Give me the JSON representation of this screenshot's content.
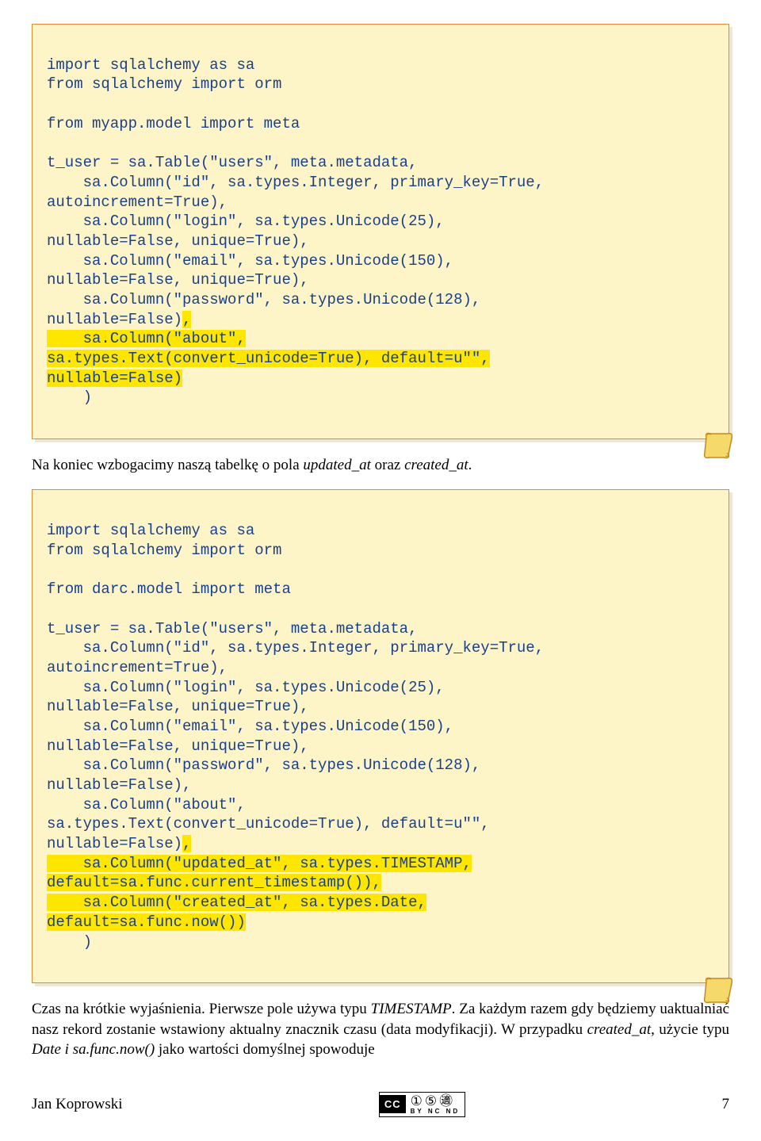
{
  "code1": {
    "l01": "import sqlalchemy as sa",
    "l02": "from sqlalchemy import orm",
    "l03": "",
    "l04": "from myapp.model import meta",
    "l05": "",
    "l06": "t_user = sa.Table(\"users\", meta.metadata,",
    "l07": "    sa.Column(\"id\", sa.types.Integer, primary_key=True,",
    "l08": "autoincrement=True),",
    "l09": "    sa.Column(\"login\", sa.types.Unicode(25),",
    "l10": "nullable=False, unique=True),",
    "l11": "    sa.Column(\"email\", sa.types.Unicode(150),",
    "l12": "nullable=False, unique=True),",
    "l13": "    sa.Column(\"password\", sa.types.Unicode(128),",
    "l14a": "nullable=False)",
    "l14b": ",",
    "l15": "    sa.Column(\"about\",",
    "l16": "sa.types.Text(convert_unicode=True), default=u\"\",",
    "l17": "nullable=False)",
    "l18": "    )"
  },
  "para1": {
    "t1": "Na koniec wzbogacimy naszą tabelkę o pola ",
    "i1": "updated_at",
    "t2": " oraz ",
    "i2": "created_at",
    "t3": "."
  },
  "code2": {
    "l01": "import sqlalchemy as sa",
    "l02": "from sqlalchemy import orm",
    "l03": "",
    "l04": "from darc.model import meta",
    "l05": "",
    "l06": "t_user = sa.Table(\"users\", meta.metadata,",
    "l07": "    sa.Column(\"id\", sa.types.Integer, primary_key=True,",
    "l08": "autoincrement=True),",
    "l09": "    sa.Column(\"login\", sa.types.Unicode(25),",
    "l10": "nullable=False, unique=True),",
    "l11": "    sa.Column(\"email\", sa.types.Unicode(150),",
    "l12": "nullable=False, unique=True),",
    "l13": "    sa.Column(\"password\", sa.types.Unicode(128),",
    "l14": "nullable=False),",
    "l15": "    sa.Column(\"about\",",
    "l16": "sa.types.Text(convert_unicode=True), default=u\"\",",
    "l17a": "nullable=False)",
    "l17b": ",",
    "l18": "    sa.Column(\"updated_at\", sa.types.TIMESTAMP,",
    "l19": "default=sa.func.current_timestamp()),",
    "l20": "    sa.Column(\"created_at\", sa.types.Date,",
    "l21": "default=sa.func.now())",
    "l22": "    )"
  },
  "para2": {
    "t1": "Czas na krótkie wyjaśnienia. Pierwsze pole używa typu ",
    "i1": "TIMESTAMP",
    "t2": ". Za każdym razem gdy będziemy uaktualniać nasz rekord zostanie wstawiony aktualny znacznik czasu (data modyfikacji). W przypadku ",
    "i2": "created_at",
    "t3": ", użycie typu ",
    "i3": "Date i sa.func.now()",
    "t4": " jako wartości domyślnej spowoduje"
  },
  "footer": {
    "author": "Jan Koprowski",
    "cc_left": "CC",
    "cc_sub": "BY  NC  ND",
    "page": "7"
  }
}
